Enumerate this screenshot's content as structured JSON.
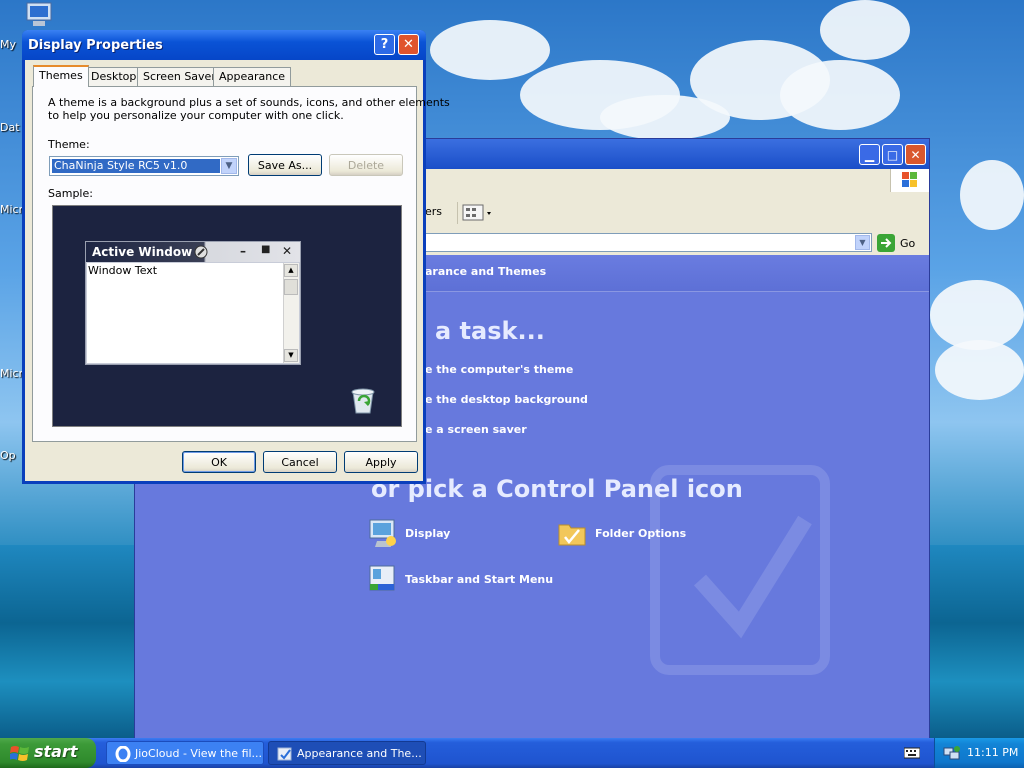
{
  "desktop": {
    "icons": [
      {
        "label": "My"
      },
      {
        "label": "Dat"
      },
      {
        "label": "Micr"
      },
      {
        "label": "Micr"
      },
      {
        "label": "Op"
      }
    ]
  },
  "control_panel": {
    "toolbar_partial_label": "ers",
    "address_go_label": "Go",
    "header_title": "arance and Themes",
    "pick_task": "a task...",
    "tasks": [
      "e the computer's theme",
      "e the desktop background",
      "e a screen saver"
    ],
    "pick_icon": "or pick a Control Panel icon",
    "icons": [
      {
        "label": "Display"
      },
      {
        "label": "Folder Options"
      },
      {
        "label": "Taskbar and Start Menu"
      }
    ]
  },
  "dialog": {
    "title": "Display Properties",
    "help_label": "?",
    "close_label": "✕",
    "tabs": [
      {
        "label": "Themes",
        "active": true
      },
      {
        "label": "Desktop"
      },
      {
        "label": "Screen Saver"
      },
      {
        "label": "Appearance"
      }
    ],
    "description_line1": "A theme is a background plus a set of sounds, icons, and other elements",
    "description_line2": "to help you personalize your computer with one click.",
    "theme_label": "Theme:",
    "theme_value": "ChaNinja Style RC5 v1.0",
    "save_as_label": "Save As...",
    "delete_label": "Delete",
    "sample_label": "Sample:",
    "sample_window_title": "Active Window",
    "sample_window_text": "Window Text",
    "ok_label": "OK",
    "cancel_label": "Cancel",
    "apply_label": "Apply"
  },
  "taskbar": {
    "start_label": "start",
    "tasks": [
      {
        "label": "JioCloud - View the fil..."
      },
      {
        "label": "Appearance and The..."
      }
    ],
    "clock": "11:11 PM"
  }
}
